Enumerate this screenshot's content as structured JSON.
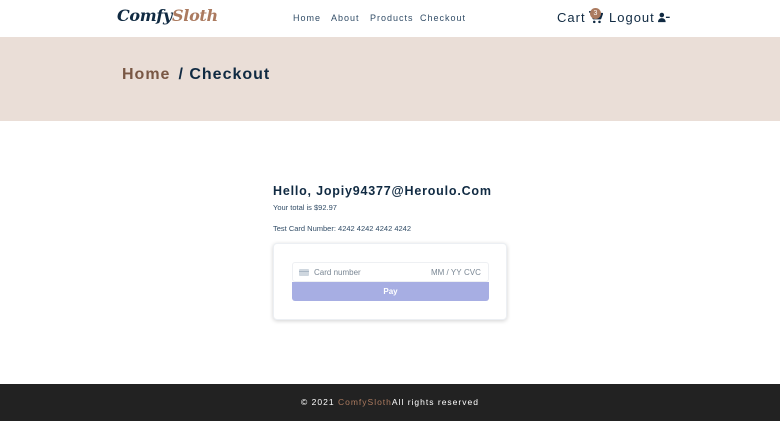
{
  "navbar": {
    "logo": {
      "main": "Comfy",
      "accent": "Sloth"
    },
    "links": [
      "Home",
      "About",
      "Products",
      "Checkout"
    ],
    "cart_label": "Cart",
    "cart_count": "3",
    "logout_label": "Logout",
    "icons": {
      "cart": "shopping-cart-icon",
      "logout": "user-minus-icon"
    }
  },
  "hero": {
    "crumb_home": "Home",
    "crumb_current": "/ Checkout"
  },
  "checkout": {
    "greeting": "Hello, Jopiy94377@Heroulo.Com",
    "total_text": "Your total is $92.97",
    "card_hint": "Test Card Number: 4242 4242 4242 4242",
    "card_placeholder": "Card number",
    "expiry_placeholder": "MM / YY",
    "cvc_placeholder": "CVC",
    "pay_label": "Pay"
  },
  "footer": {
    "prefix": "© 2021",
    "brand": "ComfySloth",
    "suffix": "All rights reserved"
  },
  "colors": {
    "primary": "#ab7a5f",
    "hero_bg": "#eaded7",
    "pay_button": "#a7aee3",
    "footer_bg": "#222222",
    "text_dark": "#102a42"
  }
}
